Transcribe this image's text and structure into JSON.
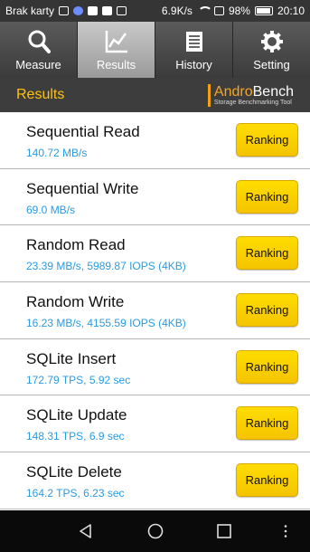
{
  "status_bar": {
    "carrier": "Brak karty",
    "speed": "6.9K/s",
    "battery": "98%",
    "time": "20:10"
  },
  "tabs": [
    {
      "label": "Measure",
      "icon": "search-icon",
      "active": false
    },
    {
      "label": "Results",
      "icon": "chart-icon",
      "active": true
    },
    {
      "label": "History",
      "icon": "list-icon",
      "active": false
    },
    {
      "label": "Setting",
      "icon": "gear-icon",
      "active": false
    }
  ],
  "header": {
    "title": "Results",
    "logo_part1": "Andro",
    "logo_part2": "Bench",
    "logo_sub": "Storage Benchmarking Tool"
  },
  "results": [
    {
      "name": "Sequential Read",
      "value": "140.72 MB/s",
      "button": "Ranking"
    },
    {
      "name": "Sequential Write",
      "value": "69.0 MB/s",
      "button": "Ranking"
    },
    {
      "name": "Random Read",
      "value": "23.39 MB/s, 5989.87 IOPS (4KB)",
      "button": "Ranking"
    },
    {
      "name": "Random Write",
      "value": "16.23 MB/s, 4155.59 IOPS (4KB)",
      "button": "Ranking"
    },
    {
      "name": "SQLite Insert",
      "value": "172.79 TPS, 5.92 sec",
      "button": "Ranking"
    },
    {
      "name": "SQLite Update",
      "value": "148.31 TPS, 6.9 sec",
      "button": "Ranking"
    },
    {
      "name": "SQLite Delete",
      "value": "164.2 TPS, 6.23 sec",
      "button": "Ranking"
    }
  ],
  "colors": {
    "accent": "#ffc20e",
    "value_text": "#2b9be0",
    "button": "#ffd500"
  },
  "nav": [
    "back-icon",
    "home-icon",
    "recents-icon",
    "menu-icon"
  ]
}
